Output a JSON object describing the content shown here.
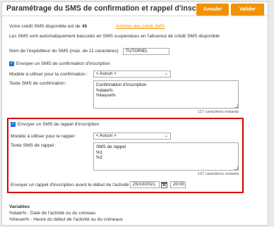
{
  "header": {
    "title": "Paramétrage du SMS de confirmation et rappel d'inscription",
    "cancel_label": "Annuler",
    "validate_label": "Valider"
  },
  "credit": {
    "label": "Votre crédit SMS disponible est de",
    "value": "45",
    "buy_link": "Acheter des crédit SMS"
  },
  "notice": "Les SMS sont automatiquement basculés en SMS suspendues en l'absence de crédit SMS disponible",
  "sender": {
    "label": "Nom de l'expéditeur du SMS (max. de 11 caractères)",
    "value": "TUTORIEL"
  },
  "confirmation": {
    "checkbox_label": "Envoyer un SMS de confirmation d'inscription",
    "checked": true,
    "model_label": "Modèle à utiliser pour la confirmation :",
    "model_value": "< Aucun >",
    "text_label": "Texte SMS de confirmation :",
    "text_value": "Confirmation d'inscription\n%date%\n%heure%",
    "counter": "117 caractères restants"
  },
  "reminder": {
    "checkbox_label": "Envoyer un SMS de rappel d'inscription",
    "checked": true,
    "model_label": "Modèle à utiliser pour le rappel :",
    "model_value": "< Aucun >",
    "text_label": "Texte SMS de rappel :",
    "text_value": "SMS de rappel\n%1\n%2",
    "counter": "137 caractères restants",
    "schedule_label": "Envoyer un rappel d'inscription avant le début de l'activité :",
    "date_value": "25/10/2021",
    "calendar_day": "31",
    "time_value": "20:00"
  },
  "variables": {
    "title": "Variables",
    "lines": [
      "%date% : Date de l'activité ou du créneau",
      "%heure% : Heure du début de l'activité ou du créneaux"
    ]
  },
  "colors": {
    "accent": "#f39200",
    "highlight_border": "#d40000",
    "checkbox": "#1a73e8"
  }
}
